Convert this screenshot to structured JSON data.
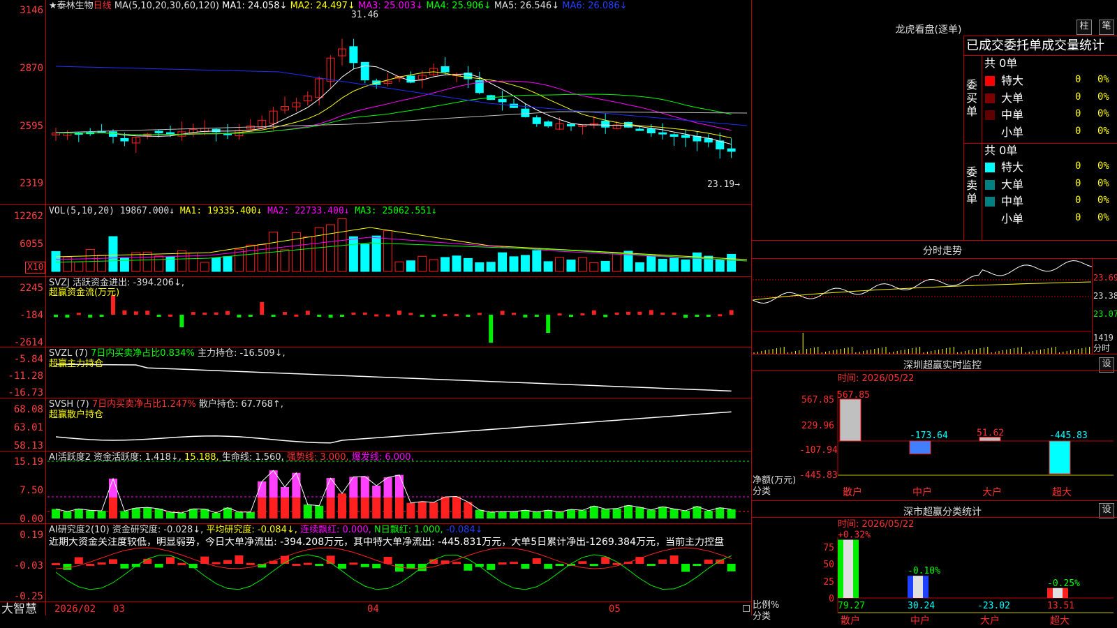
{
  "stock": {
    "star": "★",
    "name": "泰林生物",
    "period": "日线"
  },
  "ma_line": {
    "label": "MA(5,10,20,30,60,120)",
    "ma1": "MA1: 24.058↓",
    "ma2": "MA2: 24.497↓",
    "ma3": "MA3: 25.003↓",
    "ma4": "MA4: 25.906↓",
    "ma5": "MA5: 26.546↓",
    "ma6": "MA6: 26.086↓"
  },
  "price_axis": [
    "3146",
    "2870",
    "2595",
    "2319"
  ],
  "price_marks": {
    "high": "31.46",
    "low": "23.19→"
  },
  "vol": {
    "label": "VOL(5,10,20)",
    "value": "19867.000↓",
    "ma1": "MA1: 19335.400↓",
    "ma2": "MA2: 22733.400↓",
    "ma3": "MA3: 25062.551↓",
    "axis": [
      "12262",
      "6055"
    ],
    "unit": "X10"
  },
  "svzj": {
    "label": "SVZJ",
    "desc": "活跃资金进出: -394.206↓,",
    "title": "超赢资金流(万元)",
    "axis": [
      "2245",
      "-184",
      "-2614"
    ]
  },
  "svzl": {
    "label": "SVZL (7)",
    "ratio": "7日内买卖净占比0.834%",
    "value": "主力持仓: -16.509↓,",
    "title": "超赢主力持仓",
    "axis": [
      "-5.84",
      "-11.28",
      "-16.73"
    ]
  },
  "svsh": {
    "label": "SVSH (7)",
    "ratio": "7日内买卖净占比1.247%",
    "value": "散户持仓: 67.768↑,",
    "title": "超赢散户持仓",
    "axis": [
      "68.08",
      "63.01",
      "58.13"
    ]
  },
  "ai_active": {
    "label": "AI活跃度2",
    "a": "资金活跃度: 1.418↓,",
    "b": "15.188,",
    "c": "生命线: 1.560,",
    "d": "强势线: 3.000,",
    "e": "爆发线: 6.000,",
    "axis": [
      "15.19",
      "7.50",
      "0.00"
    ]
  },
  "ai_research": {
    "label": "AI研究度2(10)",
    "a": "资金研究度: -0.028↓,",
    "b": "平均研究度: -0.084↓,",
    "c": "连续飘红: 0.000,",
    "d": "N日飘红: 1.000,",
    "e": "-0.084↓",
    "comment": "近期大资金关注度较低，明显弱势，今日大单净流出: -394.208万元，其中特大单净流出: -445.831万元，大单5日累计净出-1269.384万元，当前主力控盘",
    "axis": [
      "0.19",
      "-0.03",
      "-0.25"
    ]
  },
  "bottom_bar": {
    "brand": "大智慧",
    "dates": [
      "2026/02",
      "03",
      "04",
      "05"
    ]
  },
  "dragon": {
    "title": "龙虎看盘(逐单)",
    "btn1": "柱",
    "btn2": "笔",
    "header": "已成交委托单成交量统计",
    "buy": {
      "side": "委买单",
      "total": "共 0单",
      "rows": [
        {
          "name": "特大",
          "v": "0",
          "p": "0%"
        },
        {
          "name": "大单",
          "v": "0",
          "p": "0%"
        },
        {
          "name": "中单",
          "v": "0",
          "p": "0%"
        },
        {
          "name": "小单",
          "v": "0",
          "p": "0%"
        }
      ]
    },
    "sell": {
      "side": "委卖单",
      "total": "共 0单",
      "rows": [
        {
          "name": "特大",
          "v": "0",
          "p": "0%"
        },
        {
          "name": "大单",
          "v": "0",
          "p": "0%"
        },
        {
          "name": "中单",
          "v": "0",
          "p": "0%"
        },
        {
          "name": "小单",
          "v": "0",
          "p": "0%"
        }
      ]
    }
  },
  "intraday": {
    "title": "分时走势",
    "axis": [
      "23.69",
      "23.38",
      "23.07",
      "1419"
    ],
    "unit": "分时"
  },
  "monitor": {
    "title": "深圳超赢实时监控",
    "btn": "设",
    "time": "时间: 2026/05/22",
    "axis": [
      "567.85",
      "229.96",
      "-107.94",
      "-445.83"
    ],
    "ylabel": "净额(万元)",
    "xlabel": "分类",
    "bars": [
      {
        "cat": "散户",
        "value": 567.85,
        "label": "567.85"
      },
      {
        "cat": "中户",
        "value": -173.64,
        "label": "-173.64"
      },
      {
        "cat": "大户",
        "value": 51.62,
        "label": "51.62"
      },
      {
        "cat": "超大",
        "value": -445.83,
        "label": "-445.83"
      }
    ]
  },
  "classify": {
    "title": "深市超赢分类统计",
    "btn": "设",
    "time": "时间: 2026/05/22",
    "axis": [
      "75",
      "50",
      "25",
      "0"
    ],
    "ylabel": "比例%",
    "xlabel": "分类",
    "bars": [
      {
        "cat": "散户",
        "value": 79.27,
        "label": "79.27",
        "change": "+0.32%"
      },
      {
        "cat": "中户",
        "value": 30.24,
        "label": "30.24",
        "change": "-0.10%"
      },
      {
        "cat": "大户",
        "value": -23.02,
        "label": "-23.02",
        "change": ""
      },
      {
        "cat": "超大",
        "value": 13.51,
        "label": "13.51",
        "change": "-0.25%"
      }
    ]
  },
  "colors": {
    "up": "#ff2020",
    "down": "#00ffff",
    "green": "#00ee00",
    "grid": "#c00000",
    "ma1": "#ffffff",
    "ma2": "#ffff00",
    "ma3": "#ff00ff",
    "ma4": "#00ff00",
    "ma5": "#c0c0c0",
    "ma6": "#0000ff"
  }
}
